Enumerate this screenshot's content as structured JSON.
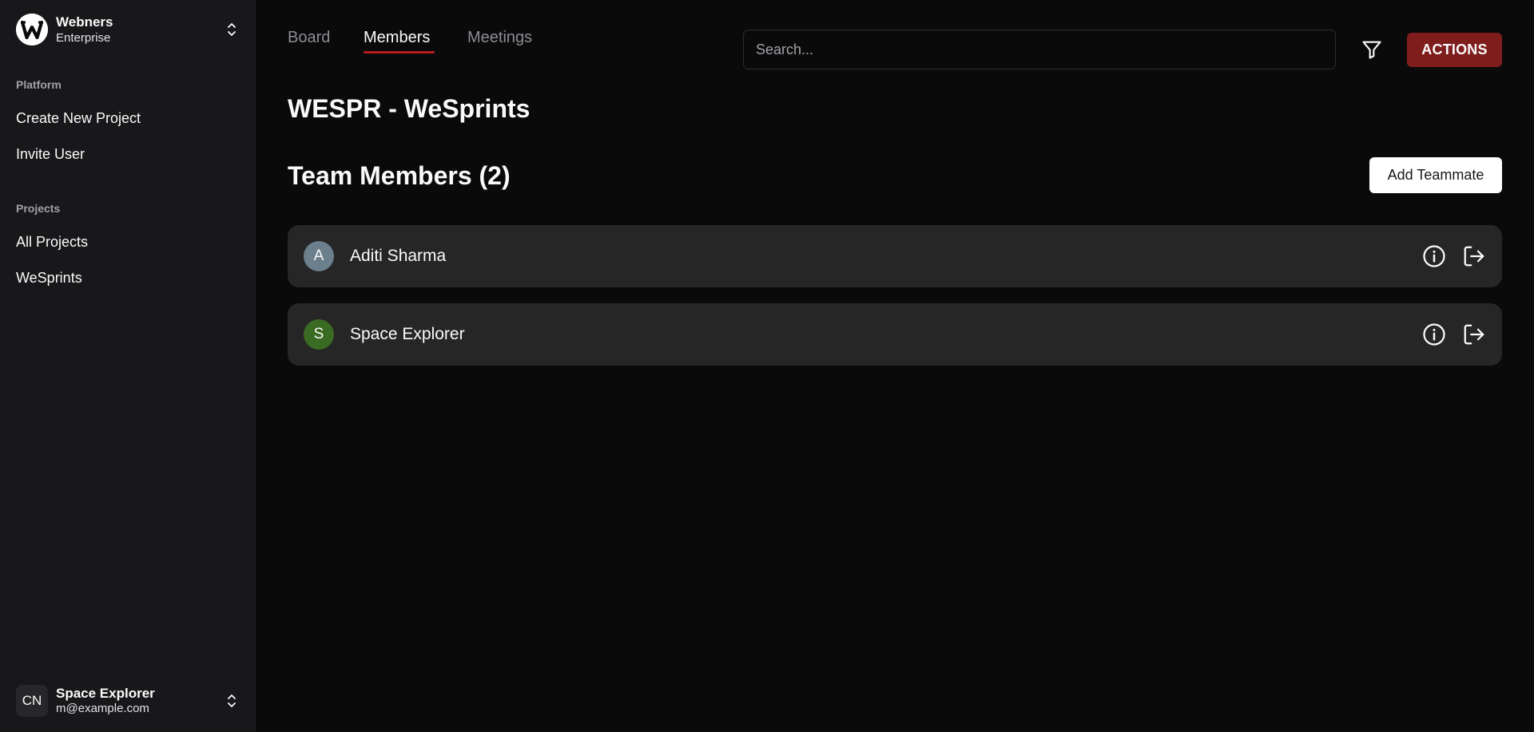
{
  "sidebar": {
    "org": {
      "name": "Webners",
      "plan": "Enterprise",
      "logo_letter": "W"
    },
    "sections": [
      {
        "label": "Platform",
        "items": [
          {
            "label": "Create New Project"
          },
          {
            "label": "Invite User"
          }
        ]
      },
      {
        "label": "Projects",
        "items": [
          {
            "label": "All Projects"
          },
          {
            "label": "WeSprints"
          }
        ]
      }
    ],
    "user": {
      "initials": "CN",
      "name": "Space Explorer",
      "email": "m@example.com"
    }
  },
  "header": {
    "tabs": [
      {
        "label": "Board",
        "active": false
      },
      {
        "label": "Members",
        "active": true
      },
      {
        "label": "Meetings",
        "active": false
      }
    ],
    "search": {
      "placeholder": "Search...",
      "value": ""
    },
    "filter_icon": "filter-icon",
    "actions_label": "ACTIONS"
  },
  "main": {
    "project_title": "WESPR - WeSprints",
    "team_heading": "Team Members (2)",
    "add_button_label": "Add Teammate",
    "members": [
      {
        "initial": "A",
        "name": "Aditi Sharma",
        "avatar_color": "#6b7f8c"
      },
      {
        "initial": "S",
        "name": "Space Explorer",
        "avatar_color": "#3a6b23"
      }
    ]
  },
  "colors": {
    "accent": "#b91c1c",
    "actions_button": "#7f1d1d",
    "sidebar_bg": "#18181b",
    "page_bg": "#0a0a0a",
    "row_bg": "#262626"
  }
}
